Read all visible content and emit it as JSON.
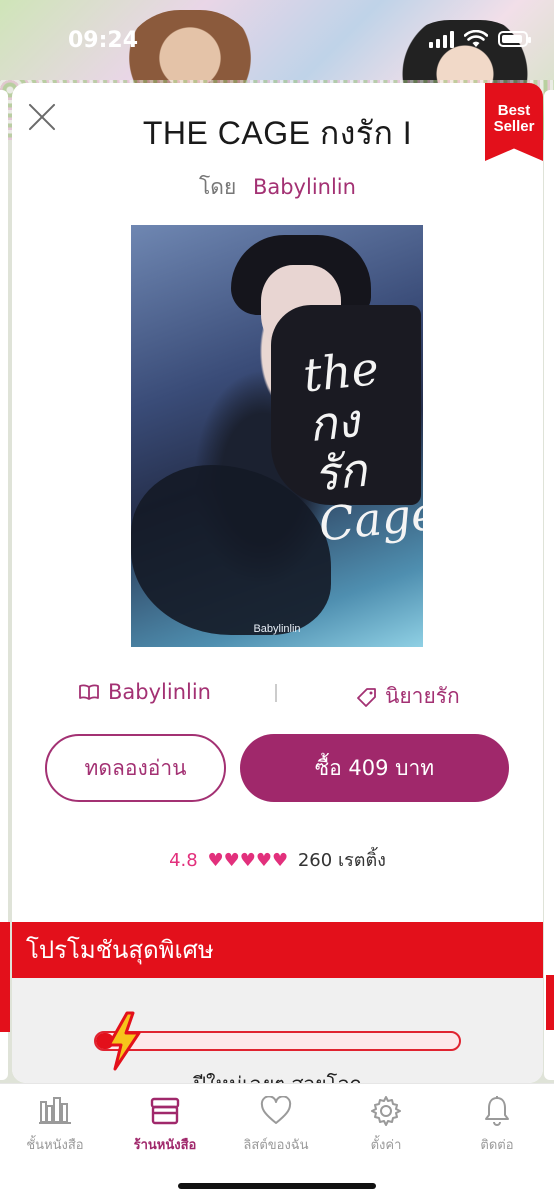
{
  "status": {
    "time": "09:24"
  },
  "book": {
    "title": "THE CAGE กงรัก I",
    "by_label": "โดย",
    "author": "Babylinlin",
    "badge": "Best Seller",
    "cover": {
      "script_text": "the กงรัก Cage",
      "author_text": "Babylinlin"
    },
    "publisher": "Babylinlin",
    "category": "นิยายรัก"
  },
  "actions": {
    "sample_label": "ทดลองอ่าน",
    "buy_label": "ซื้อ 409 บาท"
  },
  "rating": {
    "score": "4.8",
    "hearts": "♥♥♥♥♥",
    "count_label": "260 เรตติ้ง"
  },
  "promo": {
    "header": "โปรโมชันสุดพิเศษ",
    "progress": 0.05,
    "text": "ปีใหม่เฉยๆ สวยโลก"
  },
  "tabs": [
    {
      "label": "ชั้นหนังสือ",
      "icon": "bookshelf-icon"
    },
    {
      "label": "ร้านหนังสือ",
      "icon": "store-icon",
      "active": true
    },
    {
      "label": "ลิสต์ของฉัน",
      "icon": "heart-icon"
    },
    {
      "label": "ตั้งค่า",
      "icon": "gear-icon"
    },
    {
      "label": "ติดต่อ",
      "icon": "bell-icon"
    }
  ],
  "colors": {
    "accent": "#a0286b",
    "promo_red": "#e3101b",
    "heart_pink": "#e2307c"
  }
}
